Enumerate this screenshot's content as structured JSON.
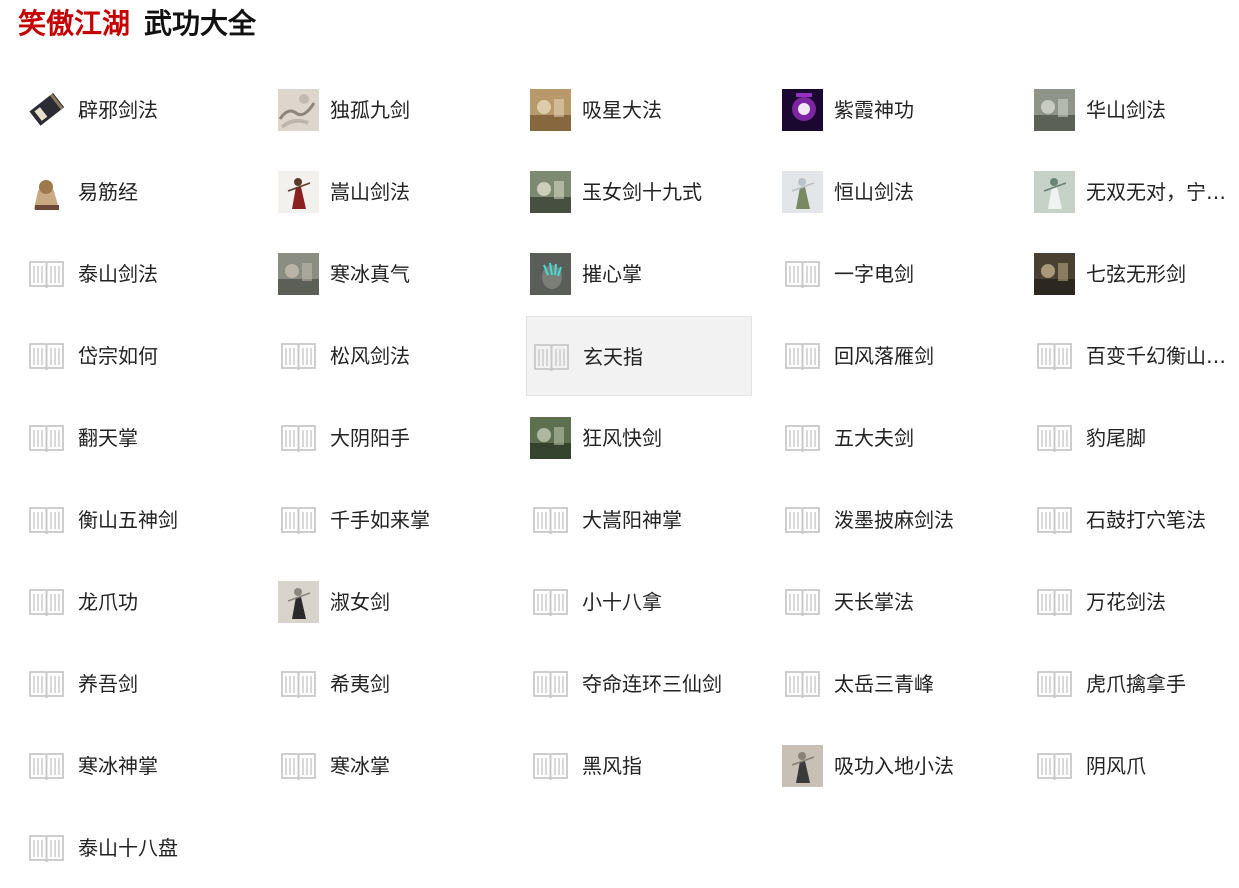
{
  "header": {
    "brand": "笑傲江湖",
    "title": "武功大全"
  },
  "colors": {
    "brand": "#c40000",
    "text": "#222222",
    "hover_bg": "#f2f2f2",
    "book_icon": "#c8c8c8"
  },
  "items": [
    {
      "label": "辟邪剑法",
      "icon": "book-scroll-photo"
    },
    {
      "label": "独孤九剑",
      "icon": "ink-painting-photo"
    },
    {
      "label": "吸星大法",
      "icon": "scene-photo"
    },
    {
      "label": "紫霞神功",
      "icon": "purple-glow-photo"
    },
    {
      "label": "华山剑法",
      "icon": "scene-photo"
    },
    {
      "label": "易筋经",
      "icon": "statue-photo"
    },
    {
      "label": "嵩山剑法",
      "icon": "figure-photo"
    },
    {
      "label": "玉女剑十九式",
      "icon": "scene-photo"
    },
    {
      "label": "恒山剑法",
      "icon": "figure-photo"
    },
    {
      "label": "无双无对，宁氏一剑",
      "icon": "figure-photo"
    },
    {
      "label": "泰山剑法",
      "icon": "book-icon"
    },
    {
      "label": "寒冰真气",
      "icon": "scene-photo"
    },
    {
      "label": "摧心掌",
      "icon": "glowing-hand-photo"
    },
    {
      "label": "一字电剑",
      "icon": "book-icon"
    },
    {
      "label": "七弦无形剑",
      "icon": "scene-photo"
    },
    {
      "label": "岱宗如何",
      "icon": "book-icon"
    },
    {
      "label": "松风剑法",
      "icon": "book-icon"
    },
    {
      "label": "玄天指",
      "icon": "book-icon",
      "state": "hover"
    },
    {
      "label": "回风落雁剑",
      "icon": "book-icon"
    },
    {
      "label": "百变千幻衡山云雾十三式",
      "icon": "book-icon"
    },
    {
      "label": "翻天掌",
      "icon": "book-icon"
    },
    {
      "label": "大阴阳手",
      "icon": "book-icon"
    },
    {
      "label": "狂风快剑",
      "icon": "scene-photo"
    },
    {
      "label": "五大夫剑",
      "icon": "book-icon"
    },
    {
      "label": "豹尾脚",
      "icon": "book-icon"
    },
    {
      "label": "衡山五神剑",
      "icon": "book-icon"
    },
    {
      "label": "千手如来掌",
      "icon": "book-icon"
    },
    {
      "label": "大嵩阳神掌",
      "icon": "book-icon"
    },
    {
      "label": "泼墨披麻剑法",
      "icon": "book-icon"
    },
    {
      "label": "石鼓打穴笔法",
      "icon": "book-icon"
    },
    {
      "label": "龙爪功",
      "icon": "book-icon"
    },
    {
      "label": "淑女剑",
      "icon": "figure-photo"
    },
    {
      "label": "小十八拿",
      "icon": "book-icon"
    },
    {
      "label": "天长掌法",
      "icon": "book-icon"
    },
    {
      "label": "万花剑法",
      "icon": "book-icon"
    },
    {
      "label": "养吾剑",
      "icon": "book-icon"
    },
    {
      "label": "希夷剑",
      "icon": "book-icon"
    },
    {
      "label": "夺命连环三仙剑",
      "icon": "book-icon"
    },
    {
      "label": "太岳三青峰",
      "icon": "book-icon"
    },
    {
      "label": "虎爪擒拿手",
      "icon": "book-icon"
    },
    {
      "label": "寒冰神掌",
      "icon": "book-icon"
    },
    {
      "label": "寒冰掌",
      "icon": "book-icon"
    },
    {
      "label": "黑风指",
      "icon": "book-icon"
    },
    {
      "label": "吸功入地小法",
      "icon": "figure-photo"
    },
    {
      "label": "阴风爪",
      "icon": "book-icon"
    },
    {
      "label": "泰山十八盘",
      "icon": "book-icon"
    }
  ]
}
